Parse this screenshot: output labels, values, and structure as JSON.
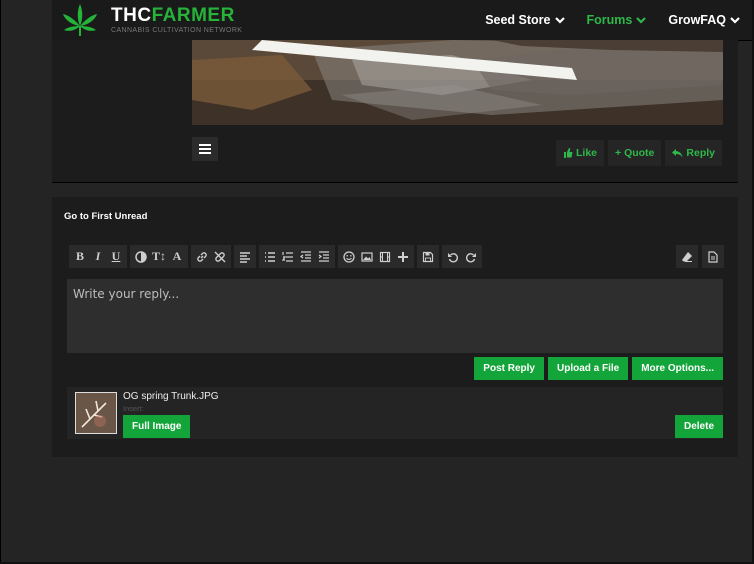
{
  "header": {
    "brand_part1": "THC",
    "brand_part2": "FARMER",
    "tagline": "CANNABIS CULTIVATION NETWORK",
    "logo_icon": "cannabis-leaf-icon",
    "nav": [
      {
        "label": "Seed Store"
      },
      {
        "label": "Forums"
      },
      {
        "label": "GrowFAQ"
      }
    ]
  },
  "post": {
    "actions": {
      "like": "Like",
      "quote": "+ Quote",
      "reply": "Reply"
    }
  },
  "reply": {
    "go_first_unread": "Go to First Unread",
    "placeholder": "Write your reply...",
    "buttons": {
      "post_reply": "Post Reply",
      "upload_file": "Upload a File",
      "more_options": "More Options..."
    },
    "toolbar_letters": {
      "bold": "B",
      "italic": "I",
      "underline": "U",
      "size": "T↕",
      "font": "A"
    }
  },
  "attachment": {
    "filename": "OG spring Trunk.JPG",
    "insert_label": "Insert:",
    "full_image": "Full Image",
    "delete": "Delete"
  },
  "colors": {
    "accent_green": "#13a53a",
    "nav_active": "#2fb84a",
    "panel_bg": "#1c1c1c",
    "page_bg": "#242424"
  }
}
